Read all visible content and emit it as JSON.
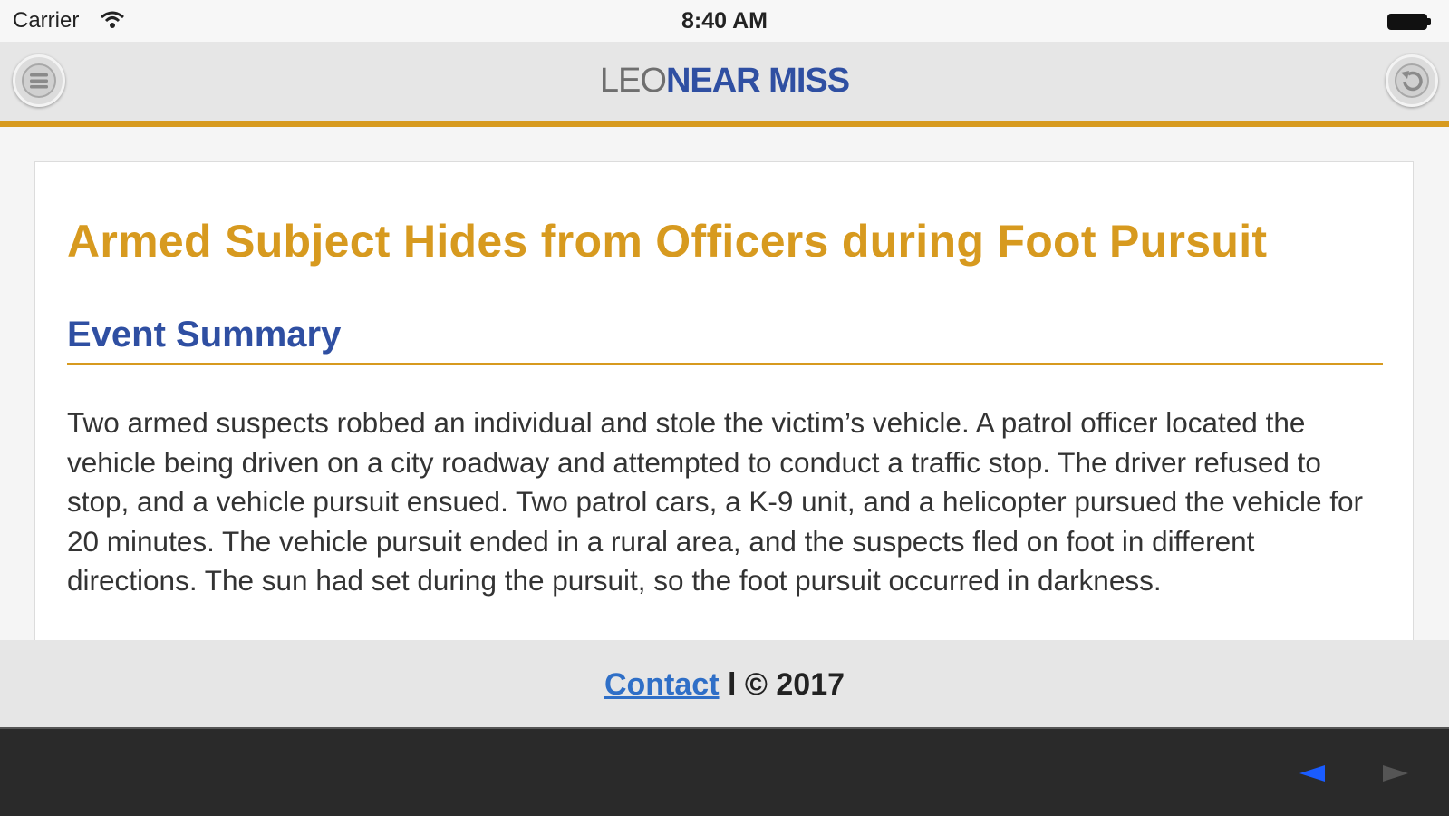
{
  "status_bar": {
    "carrier": "Carrier",
    "time": "8:40 AM"
  },
  "header": {
    "brand_part1": "LEO",
    "brand_part2": "NEAR MISS",
    "left_icon": "menu-icon",
    "right_icon": "back-arrow-icon"
  },
  "article": {
    "title": "Armed Subject Hides from Officers during Foot Pursuit",
    "section_heading": "Event Summary",
    "summary": "Two armed suspects robbed an individual and stole the victim’s vehicle. A patrol officer located the vehicle being driven on a city roadway and attempted to conduct a traffic stop. The driver refused to stop, and a vehicle pursuit ensued. Two patrol cars, a K-9 unit, and a helicopter pursued the vehicle for 20 minutes. The vehicle pursuit ended in a rural area, and the suspects fled on foot in different directions. The sun had set during the pursuit, so the foot pursuit occurred in darkness."
  },
  "footer": {
    "contact_label": "Contact",
    "separator": "l",
    "copyright": "© 2017"
  },
  "toolbar": {
    "back_icon": "triangle-left-icon",
    "forward_icon": "triangle-right-icon"
  },
  "colors": {
    "accent_gold": "#d79a1f",
    "brand_blue": "#2f4fa2",
    "link_blue": "#2f6fc7",
    "nav_active": "#1a5cff",
    "nav_disabled": "#555555"
  }
}
